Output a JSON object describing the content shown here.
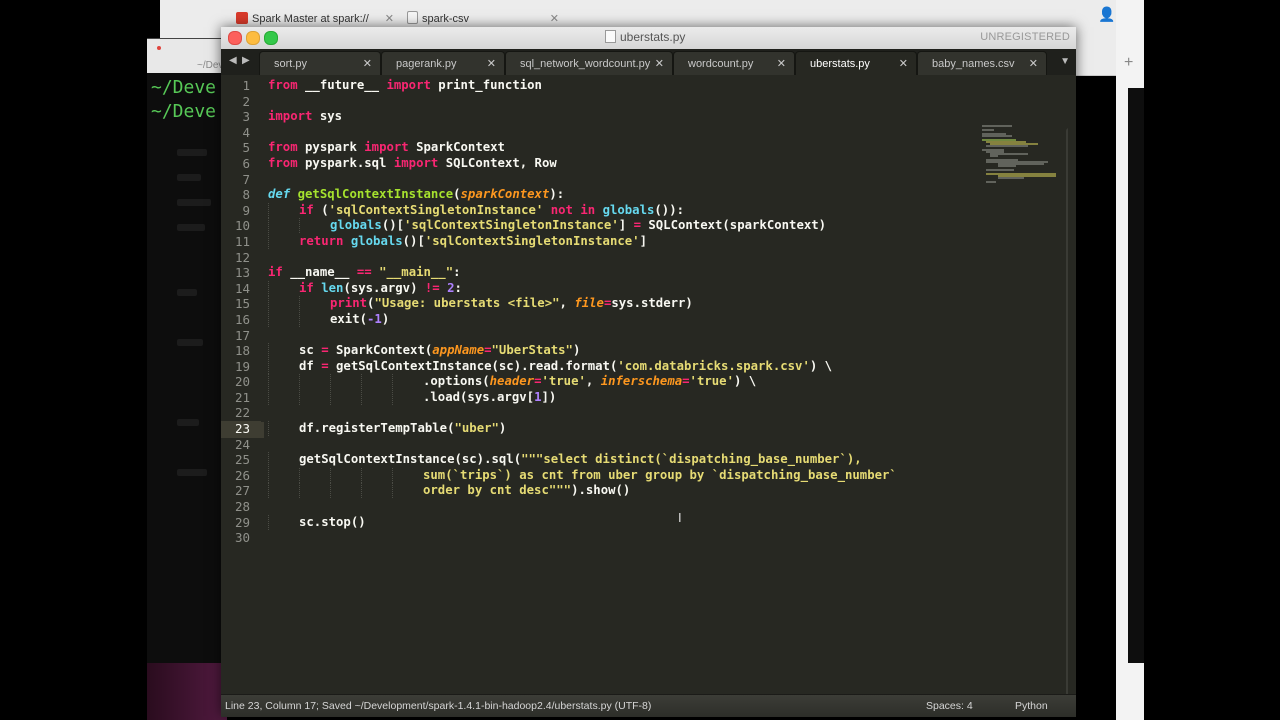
{
  "browser": {
    "tabs": [
      {
        "title": "Spark Master at spark://"
      },
      {
        "title": "spark-csv"
      }
    ]
  },
  "terminal": {
    "lines": [
      "~/Deve",
      "~/Deve"
    ],
    "tab_label": "~/Deve"
  },
  "window": {
    "title": "uberstats.py",
    "unregistered": "UNREGISTERED"
  },
  "tabs": [
    {
      "label": "sort.py",
      "active": false
    },
    {
      "label": "pagerank.py",
      "active": false
    },
    {
      "label": "sql_network_wordcount.py",
      "active": false
    },
    {
      "label": "wordcount.py",
      "active": false
    },
    {
      "label": "uberstats.py",
      "active": true
    },
    {
      "label": "baby_names.csv",
      "active": false
    }
  ],
  "editor": {
    "current_line": 23,
    "line_numbers": [
      "1",
      "2",
      "3",
      "4",
      "5",
      "6",
      "7",
      "8",
      "9",
      "10",
      "11",
      "12",
      "13",
      "14",
      "15",
      "16",
      "17",
      "18",
      "19",
      "20",
      "21",
      "22",
      "23",
      "24",
      "25",
      "26",
      "27",
      "28",
      "29",
      "30"
    ],
    "code": {
      "l1": [
        "from",
        " __future__ ",
        "import",
        " print_function"
      ],
      "l3": [
        "import",
        " sys"
      ],
      "l5": [
        "from",
        " pyspark ",
        "import",
        " SparkContext"
      ],
      "l6": [
        "from",
        " pyspark.sql ",
        "import",
        " SQLContext, Row"
      ],
      "l8": [
        "def",
        " ",
        "getSqlContextInstance",
        "(",
        "sparkContext",
        "):"
      ],
      "l9": [
        "if",
        " (",
        "'sqlContextSingletonInstance'",
        " ",
        "not in",
        " ",
        "globals",
        "()):"
      ],
      "l10": [
        "globals",
        "()[",
        "'sqlContextSingletonInstance'",
        "] ",
        "=",
        " SQLContext(sparkContext)"
      ],
      "l11": [
        "return",
        " ",
        "globals",
        "()[",
        "'sqlContextSingletonInstance'",
        "]"
      ],
      "l13": [
        "if",
        " __name__ ",
        "==",
        " ",
        "\"__main__\"",
        ":"
      ],
      "l14": [
        "if",
        " ",
        "len",
        "(sys.argv) ",
        "!=",
        " ",
        "2",
        ":"
      ],
      "l15": [
        "print",
        "(",
        "\"Usage: uberstats <file>\"",
        ", ",
        "file",
        "=",
        "sys.stderr)"
      ],
      "l16": [
        "exit(",
        "-1",
        ")"
      ],
      "l18": [
        "sc ",
        "=",
        " SparkContext(",
        "appName",
        "=",
        "\"UberStats\"",
        ")"
      ],
      "l19": [
        "df ",
        "=",
        " getSqlContextInstance(sc).read.format(",
        "'com.databricks.spark.csv'",
        ") \\"
      ],
      "l20": [
        ".options(",
        "header",
        "=",
        "'true'",
        ", ",
        "inferschema",
        "=",
        "'true'",
        ") \\"
      ],
      "l21": [
        ".load(sys.argv[",
        "1",
        "])"
      ],
      "l23": [
        "df.registerTempTable(",
        "\"uber\"",
        ")"
      ],
      "l25": [
        "getSqlContextInstance(sc).sql(",
        "\"\"\"select distinct(`dispatching_base_number`),"
      ],
      "l26": [
        "sum(`trips`) as cnt from uber group by `dispatching_base_number`"
      ],
      "l27": [
        "order by cnt desc\"\"\"",
        ").show()"
      ],
      "l29": [
        "sc.stop()"
      ]
    }
  },
  "status": {
    "text": "Line 23, Column 17; Saved ~/Development/spark-1.4.1-bin-hadoop2.4/uberstats.py (UTF-8)",
    "spaces": "Spaces: 4",
    "syntax": "Python"
  },
  "colors": {
    "background": "#272822",
    "keyword": "#f92672",
    "string": "#e6db74",
    "function": "#a6e22e",
    "builtin": "#66d9ef",
    "number": "#ae81ff",
    "parameter": "#fd971f"
  }
}
